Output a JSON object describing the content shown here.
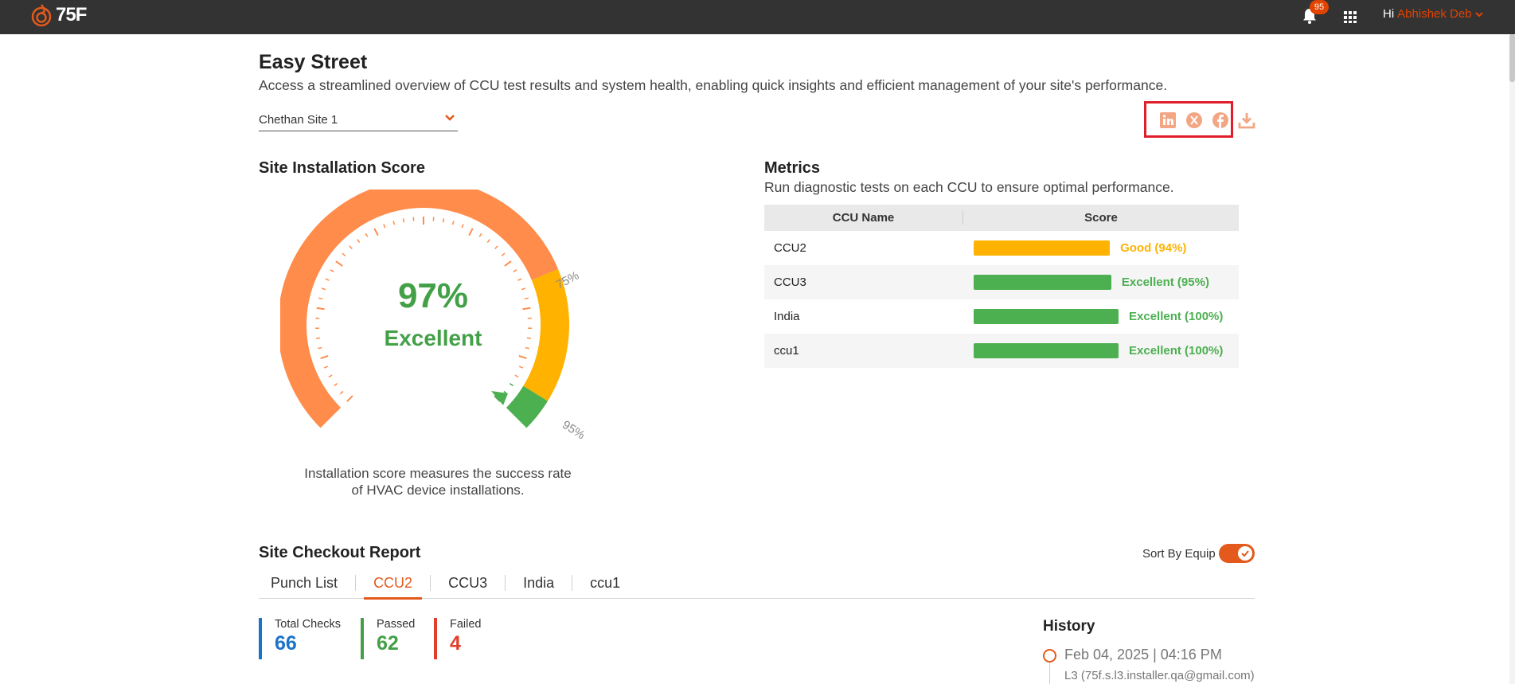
{
  "topbar": {
    "logo_text": "75F",
    "notification_count": "95",
    "greeting": "Hi",
    "user_name": "Abhishek Deb"
  },
  "header": {
    "title": "Easy Street",
    "subtitle": "Access a streamlined overview of CCU test results and system health, enabling quick insights and efficient management of your site's performance.",
    "site_select_value": "Chethan Site 1"
  },
  "share_icons": [
    "linkedin-icon",
    "x-twitter-icon",
    "facebook-icon",
    "download-icon"
  ],
  "installation_score": {
    "title": "Site Installation Score",
    "percent_text": "97%",
    "rating": "Excellent",
    "score": 97,
    "threshold_low_label": "75%",
    "threshold_high_label": "95%",
    "caption_line1": "Installation score measures the success rate",
    "caption_line2": "of HVAC device installations.",
    "colors": {
      "poor": "#ff8c4a",
      "good": "#ffb300",
      "excellent": "#4caf50"
    }
  },
  "metrics": {
    "title": "Metrics",
    "subtitle": "Run diagnostic tests on each CCU to ensure optimal performance.",
    "col_name": "CCU Name",
    "col_score": "Score",
    "rows": [
      {
        "name": "CCU2",
        "score": 94,
        "label": "Good (94%)",
        "color": "#ffb300"
      },
      {
        "name": "CCU3",
        "score": 95,
        "label": "Excellent (95%)",
        "color": "#4caf50"
      },
      {
        "name": "India",
        "score": 100,
        "label": "Excellent (100%)",
        "color": "#4caf50"
      },
      {
        "name": "ccu1",
        "score": 100,
        "label": "Excellent (100%)",
        "color": "#4caf50"
      }
    ]
  },
  "checkout": {
    "title": "Site Checkout Report",
    "sort_label": "Sort By Equip",
    "sort_enabled": true,
    "tabs": [
      "Punch List",
      "CCU2",
      "CCU3",
      "India",
      "ccu1"
    ],
    "active_tab": "CCU2",
    "stats": [
      {
        "label": "Total Checks",
        "value": "66",
        "color": "#1a73c8"
      },
      {
        "label": "Passed",
        "value": "62",
        "color": "#43a047"
      },
      {
        "label": "Failed",
        "value": "4",
        "color": "#e0402b"
      }
    ]
  },
  "history": {
    "title": "History",
    "entries": [
      {
        "date": "Feb 04, 2025 | 04:16 PM",
        "user": "L3 (75f.s.l3.installer.qa@gmail.com)"
      }
    ]
  }
}
